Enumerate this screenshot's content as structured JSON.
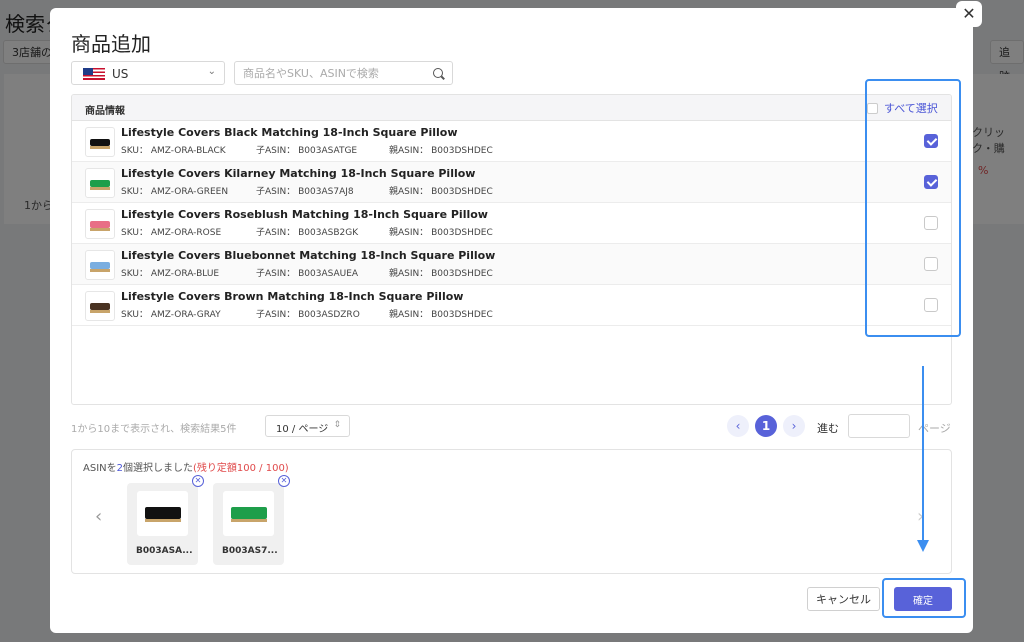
{
  "background": {
    "title": "検索ク",
    "tab_left": "3店舗の",
    "tab_right": "追跡中",
    "col_click": "クリック・購",
    "pct": "%",
    "footer": "1から"
  },
  "modal": {
    "title": "商品追加",
    "close": "✕",
    "country": "US",
    "search_placeholder": "商品名やSKU、ASINで検索",
    "table_header": "商品情報",
    "select_all": "すべて選択",
    "products": [
      {
        "title": "Lifestyle Covers Black Matching 18-Inch Square Pillow",
        "sku": "SKU： AMZ-ORA-BLACK",
        "child": "子ASIN： B003ASATGE",
        "parent": "親ASIN： B003DSHDEC",
        "checked": true,
        "color": "#111111"
      },
      {
        "title": "Lifestyle Covers Kilarney Matching 18-Inch Square Pillow",
        "sku": "SKU： AMZ-ORA-GREEN",
        "child": "子ASIN： B003AS7AJ8",
        "parent": "親ASIN： B003DSHDEC",
        "checked": true,
        "color": "#1e9e4a"
      },
      {
        "title": "Lifestyle Covers Roseblush Matching 18-Inch Square Pillow",
        "sku": "SKU： AMZ-ORA-ROSE",
        "child": "子ASIN： B003ASB2GK",
        "parent": "親ASIN： B003DSHDEC",
        "checked": false,
        "color": "#e86f86"
      },
      {
        "title": "Lifestyle Covers Bluebonnet Matching 18-Inch Square Pillow",
        "sku": "SKU： AMZ-ORA-BLUE",
        "child": "子ASIN： B003ASAUEA",
        "parent": "親ASIN： B003DSHDEC",
        "checked": false,
        "color": "#7aaee0"
      },
      {
        "title": "Lifestyle Covers Brown Matching 18-Inch Square Pillow",
        "sku": "SKU： AMZ-ORA-GRAY",
        "child": "子ASIN： B003ASDZRO",
        "parent": "親ASIN： B003DSHDEC",
        "checked": false,
        "color": "#4a3322"
      }
    ],
    "pager_info": "1から10まで表示され、検索結果5件",
    "per_page": "10 / ページ",
    "current_page": "1",
    "goto_label": "進む",
    "page_label": "ページ",
    "selected_prefix": "ASINを",
    "selected_count": "2",
    "selected_middle": "個選択しました",
    "selected_remaining": "(残り定額100 / 100)",
    "selected_items": [
      {
        "asin": "B003ASA...",
        "color": "#111111"
      },
      {
        "asin": "B003AS7...",
        "color": "#1e9e4a"
      }
    ],
    "cancel": "キャンセル",
    "confirm": "確定"
  }
}
